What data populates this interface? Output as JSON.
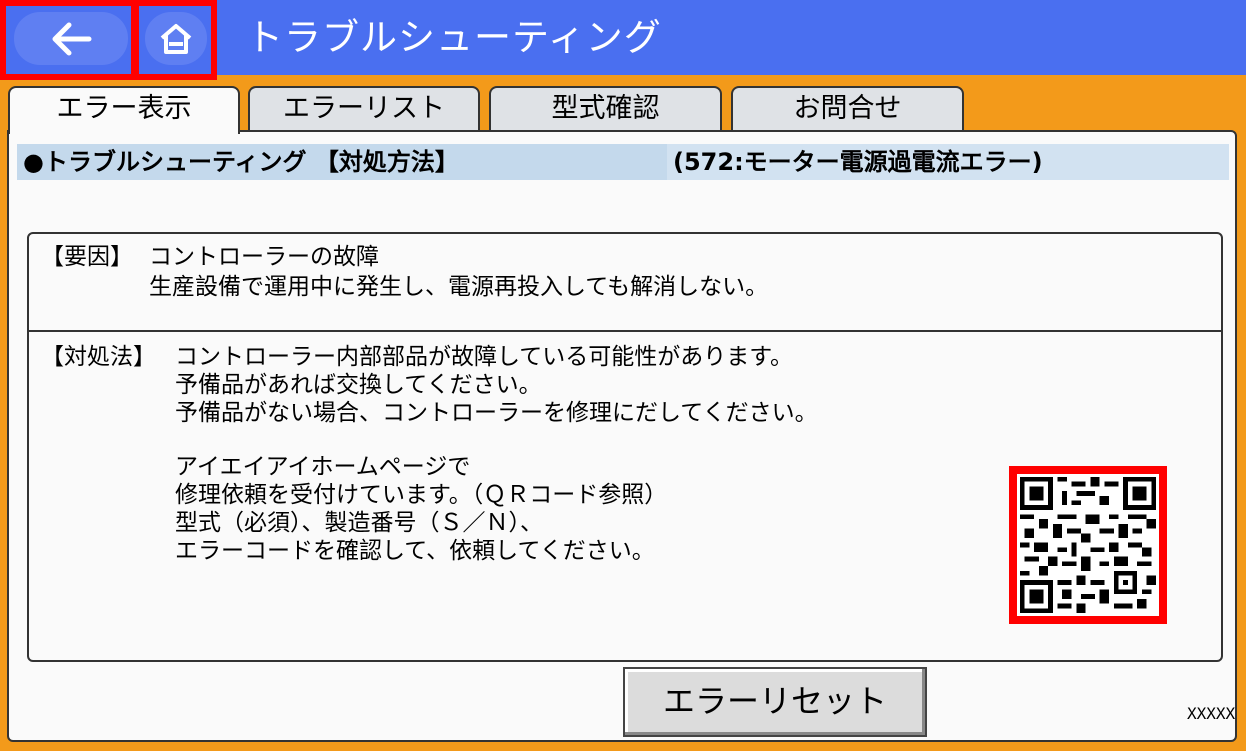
{
  "header": {
    "title": "トラブルシューティング",
    "back_icon": "arrow-left-icon",
    "home_icon": "home-icon"
  },
  "tabs": [
    {
      "label": "エラー表示",
      "active": true
    },
    {
      "label": "エラーリスト",
      "active": false
    },
    {
      "label": "型式確認",
      "active": false
    },
    {
      "label": "お問合せ",
      "active": false
    }
  ],
  "info": {
    "left": "●トラブルシューティング 【対処方法】",
    "right": "(572:モーター電源過電流エラー)"
  },
  "cause": {
    "label": "【要因】",
    "title": "コントローラーの故障",
    "text": "生産設備で運用中に発生し、電源再投入しても解消しない。"
  },
  "remedy": {
    "label": "【対処法】",
    "lines": [
      "コントローラー内部部品が故障している可能性があります。",
      "予備品があれば交換してください。",
      "予備品がない場合、コントローラーを修理にだしてください。",
      "アイエイアイホームページで",
      "修理依頼を受付けています。（ＱＲコード参照）",
      "型式（必須）、製造番号（Ｓ／Ｎ）、",
      "エラーコードを確認して、依頼してください。"
    ]
  },
  "qr_icon": "qr-code-icon",
  "reset_button": "エラーリセット",
  "code": "XXXXX",
  "colors": {
    "header": "#4a6ff0",
    "background": "#f39a1a",
    "highlight": "#ff0000",
    "info_bar": "#c4d9ec"
  }
}
